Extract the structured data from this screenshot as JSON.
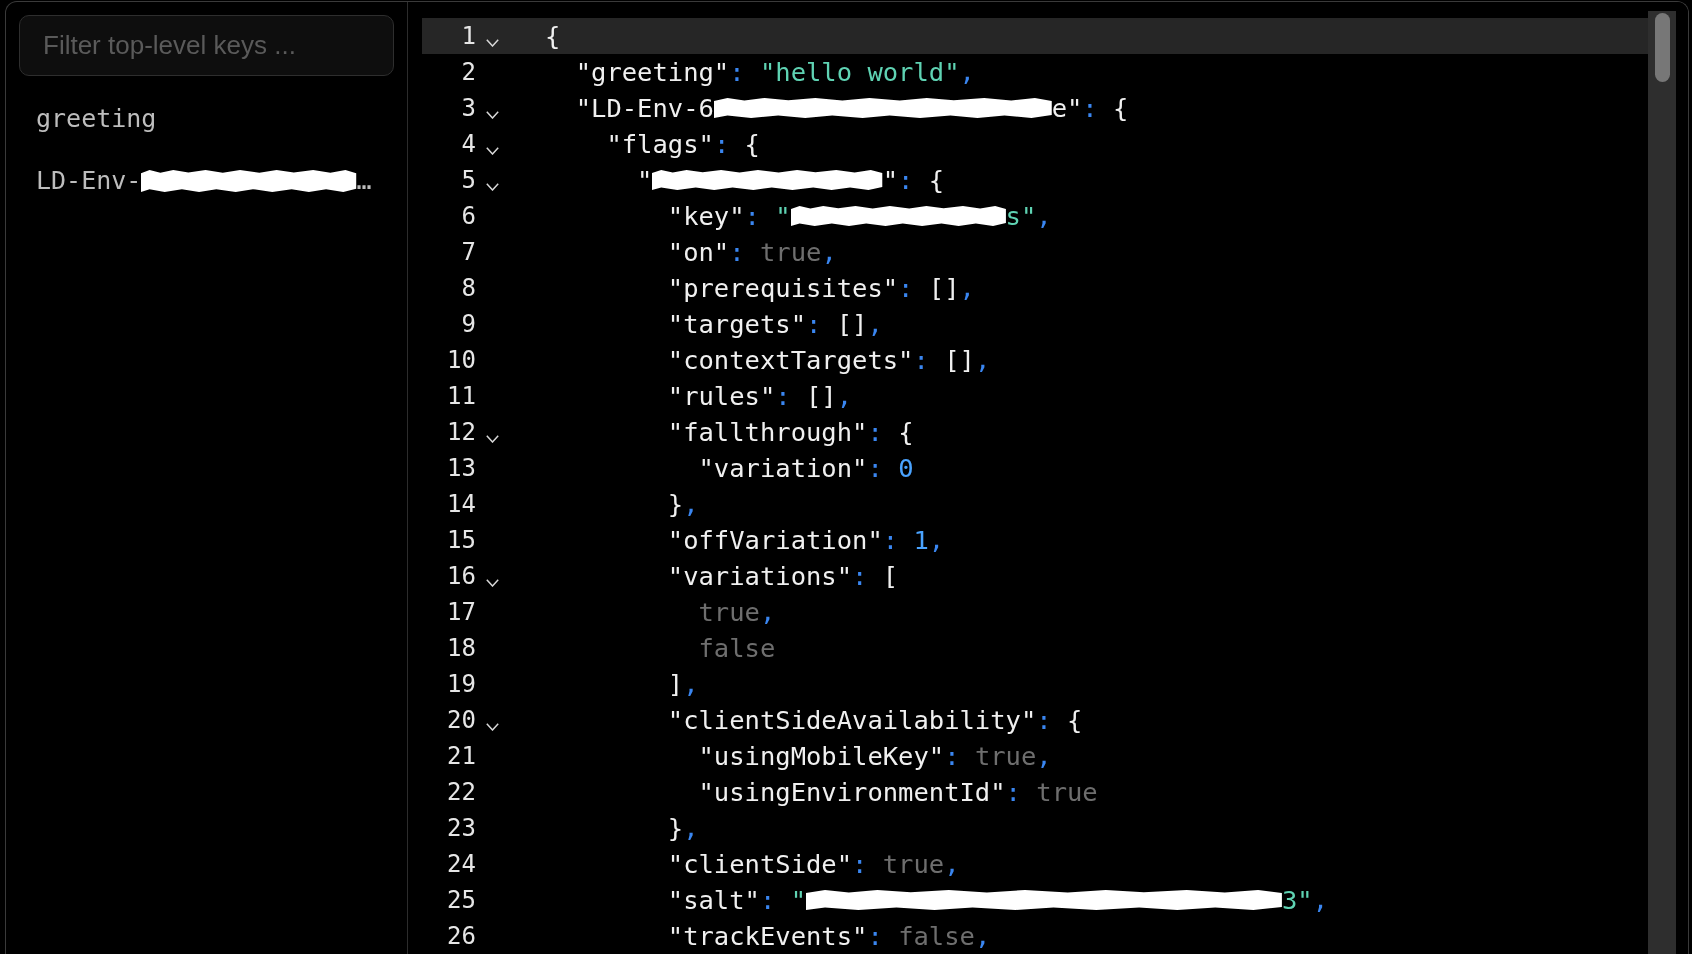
{
  "sidebar": {
    "filter": {
      "placeholder": "Filter top-level keys ..."
    },
    "items": [
      {
        "selected": false,
        "parts": [
          {
            "kind": "text",
            "text": "greeting"
          }
        ]
      },
      {
        "selected": false,
        "parts": [
          {
            "kind": "text",
            "text": "LD-Env-"
          },
          {
            "kind": "redacted"
          },
          {
            "kind": "text",
            "text": "…"
          }
        ]
      }
    ]
  },
  "editor": {
    "lines": [
      {
        "number": "1",
        "active": true,
        "expanded": true,
        "tokens": [
          {
            "kind": "bracket",
            "text": "{"
          }
        ],
        "children": [
          {
            "number": "2",
            "active": false,
            "tokens": [
              {
                "kind": "key",
                "text": "\"greeting\""
              },
              {
                "kind": "colon",
                "text": ":"
              },
              {
                "kind": "string",
                "text": "\"hello world\""
              },
              {
                "kind": "comma",
                "text": ","
              }
            ]
          },
          {
            "number": "3",
            "active": false,
            "expanded": true,
            "tokens": [
              {
                "kind": "key",
                "text": "\"LD-Env-6"
              },
              {
                "kind": "redacted"
              },
              {
                "kind": "key",
                "text": "e\""
              },
              {
                "kind": "colon",
                "text": ":"
              },
              {
                "kind": "bracket",
                "text": "{"
              }
            ],
            "children": [
              {
                "number": "4",
                "active": false,
                "expanded": true,
                "tokens": [
                  {
                    "kind": "key",
                    "text": "\"flags\""
                  },
                  {
                    "kind": "colon",
                    "text": ":"
                  },
                  {
                    "kind": "bracket",
                    "text": "{"
                  }
                ],
                "children": [
                  {
                    "number": "5",
                    "active": false,
                    "expanded": true,
                    "tokens": [
                      {
                        "kind": "key",
                        "text": "\""
                      },
                      {
                        "kind": "redacted"
                      },
                      {
                        "kind": "key",
                        "text": "\""
                      },
                      {
                        "kind": "colon",
                        "text": ":"
                      },
                      {
                        "kind": "bracket",
                        "text": "{"
                      }
                    ],
                    "children": [
                      {
                        "number": "6",
                        "active": false,
                        "tokens": [
                          {
                            "kind": "key",
                            "text": "\"key\""
                          },
                          {
                            "kind": "colon",
                            "text": ":"
                          },
                          {
                            "kind": "string",
                            "text": "\""
                          },
                          {
                            "kind": "redacted"
                          },
                          {
                            "kind": "string",
                            "text": "s\""
                          },
                          {
                            "kind": "comma",
                            "text": ","
                          }
                        ]
                      },
                      {
                        "number": "7",
                        "active": false,
                        "tokens": [
                          {
                            "kind": "key",
                            "text": "\"on\""
                          },
                          {
                            "kind": "colon",
                            "text": ":"
                          },
                          {
                            "kind": "literal",
                            "text": "true"
                          },
                          {
                            "kind": "comma",
                            "text": ","
                          }
                        ]
                      },
                      {
                        "number": "8",
                        "active": false,
                        "tokens": [
                          {
                            "kind": "key",
                            "text": "\"prerequisites\""
                          },
                          {
                            "kind": "colon",
                            "text": ":"
                          },
                          {
                            "kind": "bracket",
                            "text": "[]"
                          },
                          {
                            "kind": "comma",
                            "text": ","
                          }
                        ]
                      },
                      {
                        "number": "9",
                        "active": false,
                        "tokens": [
                          {
                            "kind": "key",
                            "text": "\"targets\""
                          },
                          {
                            "kind": "colon",
                            "text": ":"
                          },
                          {
                            "kind": "bracket",
                            "text": "[]"
                          },
                          {
                            "kind": "comma",
                            "text": ","
                          }
                        ]
                      },
                      {
                        "number": "10",
                        "active": false,
                        "tokens": [
                          {
                            "kind": "key",
                            "text": "\"contextTargets\""
                          },
                          {
                            "kind": "colon",
                            "text": ":"
                          },
                          {
                            "kind": "bracket",
                            "text": "[]"
                          },
                          {
                            "kind": "comma",
                            "text": ","
                          }
                        ]
                      },
                      {
                        "number": "11",
                        "active": false,
                        "tokens": [
                          {
                            "kind": "key",
                            "text": "\"rules\""
                          },
                          {
                            "kind": "colon",
                            "text": ":"
                          },
                          {
                            "kind": "bracket",
                            "text": "[]"
                          },
                          {
                            "kind": "comma",
                            "text": ","
                          }
                        ]
                      },
                      {
                        "number": "12",
                        "active": false,
                        "expanded": true,
                        "tokens": [
                          {
                            "kind": "key",
                            "text": "\"fallthrough\""
                          },
                          {
                            "kind": "colon",
                            "text": ":"
                          },
                          {
                            "kind": "bracket",
                            "text": "{"
                          }
                        ],
                        "children": [
                          {
                            "number": "13",
                            "active": false,
                            "tokens": [
                              {
                                "kind": "key",
                                "text": "\"variation\""
                              },
                              {
                                "kind": "colon",
                                "text": ":"
                              },
                              {
                                "kind": "number",
                                "text": "0"
                              }
                            ]
                          }
                        ]
                      },
                      {
                        "number": "14",
                        "active": false,
                        "tokens": [
                          {
                            "kind": "bracket",
                            "text": "}"
                          },
                          {
                            "kind": "comma",
                            "text": ","
                          }
                        ]
                      },
                      {
                        "number": "15",
                        "active": false,
                        "tokens": [
                          {
                            "kind": "key",
                            "text": "\"offVariation\""
                          },
                          {
                            "kind": "colon",
                            "text": ":"
                          },
                          {
                            "kind": "number",
                            "text": "1"
                          },
                          {
                            "kind": "comma",
                            "text": ","
                          }
                        ]
                      },
                      {
                        "number": "16",
                        "active": false,
                        "expanded": true,
                        "tokens": [
                          {
                            "kind": "key",
                            "text": "\"variations\""
                          },
                          {
                            "kind": "colon",
                            "text": ":"
                          },
                          {
                            "kind": "bracket",
                            "text": "["
                          }
                        ],
                        "children": [
                          {
                            "number": "17",
                            "active": false,
                            "tokens": [
                              {
                                "kind": "literal",
                                "text": "true"
                              },
                              {
                                "kind": "comma",
                                "text": ","
                              }
                            ]
                          },
                          {
                            "number": "18",
                            "active": false,
                            "tokens": [
                              {
                                "kind": "literal",
                                "text": "false"
                              }
                            ]
                          }
                        ]
                      },
                      {
                        "number": "19",
                        "active": false,
                        "tokens": [
                          {
                            "kind": "bracket",
                            "text": "]"
                          },
                          {
                            "kind": "comma",
                            "text": ","
                          }
                        ]
                      },
                      {
                        "number": "20",
                        "active": false,
                        "expanded": true,
                        "tokens": [
                          {
                            "kind": "key",
                            "text": "\"clientSideAvailability\""
                          },
                          {
                            "kind": "colon",
                            "text": ":"
                          },
                          {
                            "kind": "bracket",
                            "text": "{"
                          }
                        ],
                        "children": [
                          {
                            "number": "21",
                            "active": false,
                            "tokens": [
                              {
                                "kind": "key",
                                "text": "\"usingMobileKey\""
                              },
                              {
                                "kind": "colon",
                                "text": ":"
                              },
                              {
                                "kind": "literal",
                                "text": "true"
                              },
                              {
                                "kind": "comma",
                                "text": ","
                              }
                            ]
                          },
                          {
                            "number": "22",
                            "active": false,
                            "tokens": [
                              {
                                "kind": "key",
                                "text": "\"usingEnvironmentId\""
                              },
                              {
                                "kind": "colon",
                                "text": ":"
                              },
                              {
                                "kind": "literal",
                                "text": "true"
                              }
                            ]
                          }
                        ]
                      },
                      {
                        "number": "23",
                        "active": false,
                        "tokens": [
                          {
                            "kind": "bracket",
                            "text": "}"
                          },
                          {
                            "kind": "comma",
                            "text": ","
                          }
                        ]
                      },
                      {
                        "number": "24",
                        "active": false,
                        "tokens": [
                          {
                            "kind": "key",
                            "text": "\"clientSide\""
                          },
                          {
                            "kind": "colon",
                            "text": ":"
                          },
                          {
                            "kind": "literal",
                            "text": "true"
                          },
                          {
                            "kind": "comma",
                            "text": ","
                          }
                        ]
                      },
                      {
                        "number": "25",
                        "active": false,
                        "tokens": [
                          {
                            "kind": "key",
                            "text": "\"salt\""
                          },
                          {
                            "kind": "colon",
                            "text": ":"
                          },
                          {
                            "kind": "string",
                            "text": "\""
                          },
                          {
                            "kind": "redacted"
                          },
                          {
                            "kind": "string",
                            "text": "3\""
                          },
                          {
                            "kind": "comma",
                            "text": ","
                          }
                        ]
                      },
                      {
                        "number": "26",
                        "active": false,
                        "tokens": [
                          {
                            "kind": "key",
                            "text": "\"trackEvents\""
                          },
                          {
                            "kind": "colon",
                            "text": ":"
                          },
                          {
                            "kind": "literal",
                            "text": "false"
                          },
                          {
                            "kind": "comma",
                            "text": ","
                          }
                        ]
                      }
                    ]
                  }
                ]
              }
            ]
          }
        ]
      }
    ]
  }
}
